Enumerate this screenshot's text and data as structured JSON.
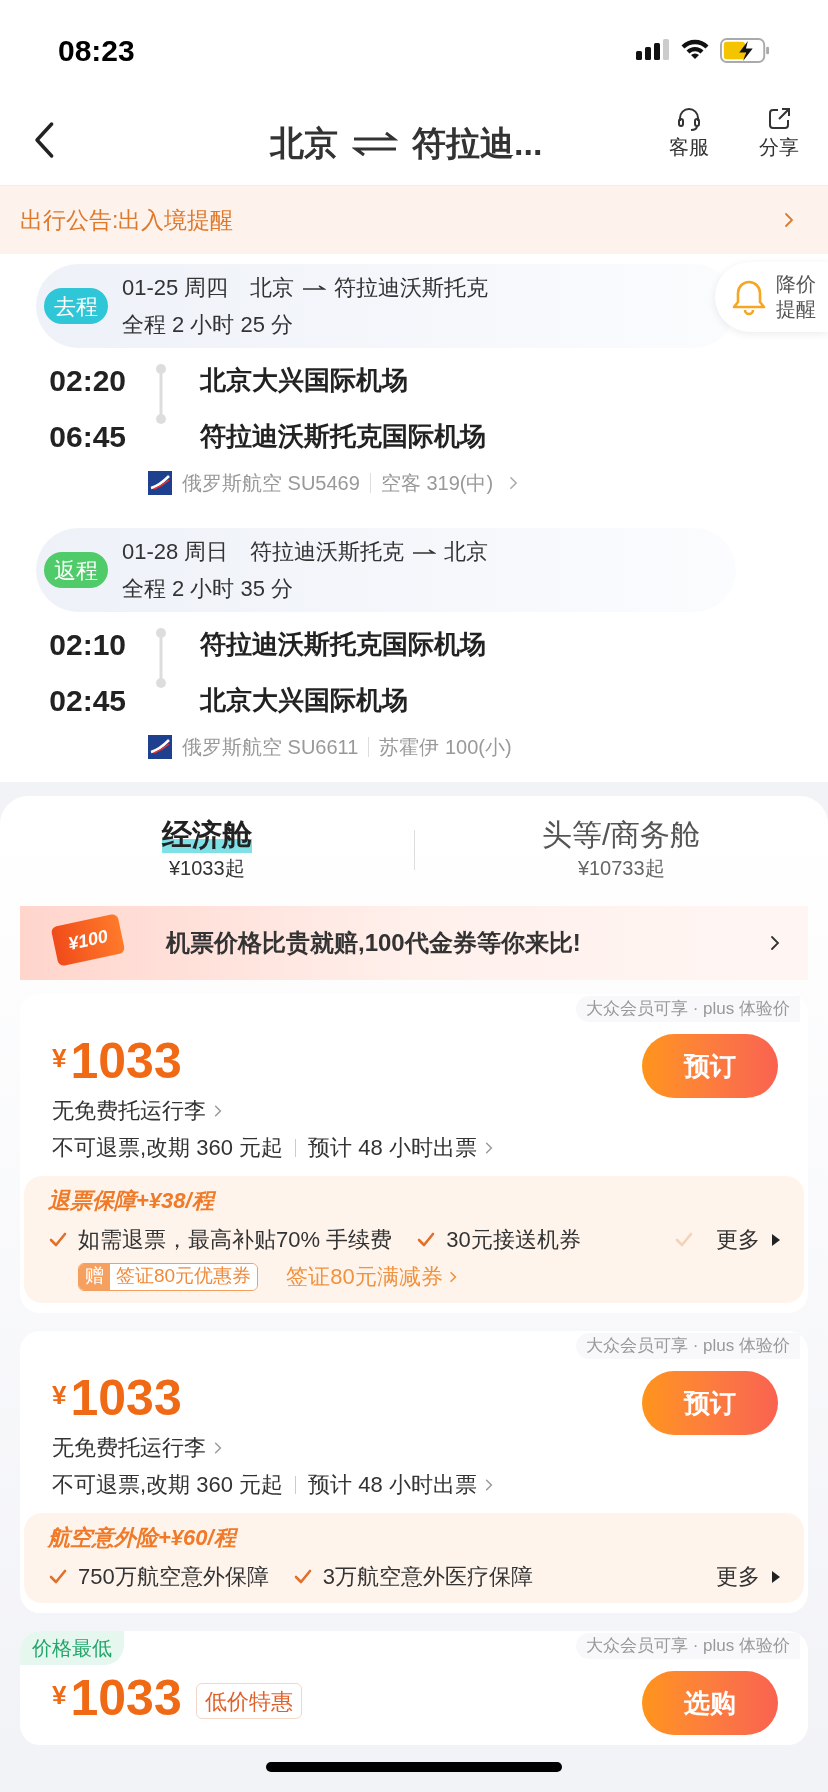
{
  "status_bar": {
    "time": "08:23"
  },
  "nav": {
    "title_from": "北京",
    "title_to": "符拉迪...",
    "actions": [
      {
        "kind": "headset",
        "label": "客服"
      },
      {
        "kind": "share",
        "label": "分享"
      }
    ]
  },
  "notice": {
    "text": "出行公告:出入境提醒"
  },
  "price_alert": {
    "label": "降价提醒"
  },
  "legs": [
    {
      "tag": "去程",
      "color": "#2fc6d8",
      "date": "01-25 周四",
      "route_from": "北京",
      "route_to": "符拉迪沃斯托克",
      "duration": "全程 2 小时 25 分",
      "dep_time": "02:20",
      "dep_airport": "北京大兴国际机场",
      "arr_time": "06:45",
      "arr_airport": "符拉迪沃斯托克国际机场",
      "flight": "俄罗斯航空 SU5469",
      "aircraft": "空客 319(中)",
      "expandable": true
    },
    {
      "tag": "返程",
      "color": "#4fcb6a",
      "date": "01-28 周日",
      "route_from": "符拉迪沃斯托克",
      "route_to": "北京",
      "duration": "全程 2 小时 35 分",
      "dep_time": "02:10",
      "dep_airport": "符拉迪沃斯托克国际机场",
      "arr_time": "02:45",
      "arr_airport": "北京大兴国际机场",
      "flight": "俄罗斯航空 SU6611",
      "aircraft": "苏霍伊 100(小)",
      "expandable": false
    }
  ],
  "cabins": [
    {
      "name": "经济舱",
      "price": "¥1033起",
      "selected": true
    },
    {
      "name": "头等/商务舱",
      "price": "¥10733起",
      "selected": false
    }
  ],
  "banner": {
    "badge": "¥100",
    "text": "机票价格比贵就赔,**100代金券**等你来比!"
  },
  "offers": [
    {
      "member_note": "大众会员可享 · plus 体验价",
      "currency": "¥",
      "price": "1033",
      "baggage": "无免费托运行李",
      "rules": "不可退票,改期 360 元起",
      "issue": "预计 48 小时出票",
      "button": "预订",
      "addon": {
        "title": "退票保障+¥38/程",
        "perks": [
          "如需退票，最高补贴70% 手续费",
          "30元接送机券"
        ],
        "more": "更多",
        "more_check": true,
        "gift_tag": "赠",
        "gift": "签证80元优惠券",
        "gift_link": "签证80元满减券"
      }
    },
    {
      "member_note": "大众会员可享 · plus 体验价",
      "currency": "¥",
      "price": "1033",
      "baggage": "无免费托运行李",
      "rules": "不可退票,改期 360 元起",
      "issue": "预计 48 小时出票",
      "button": "预订",
      "addon": {
        "title": "航空意外险+¥60/程",
        "perks": [
          "750万航空意外保障",
          "3万航空意外医疗保障"
        ],
        "more": "更多",
        "more_check": false
      }
    },
    {
      "ribbon": "价格最低",
      "member_note": "大众会员可享 · plus 体验价",
      "currency": "¥",
      "price": "1033",
      "tag": "低价特惠",
      "button": "选购"
    }
  ]
}
